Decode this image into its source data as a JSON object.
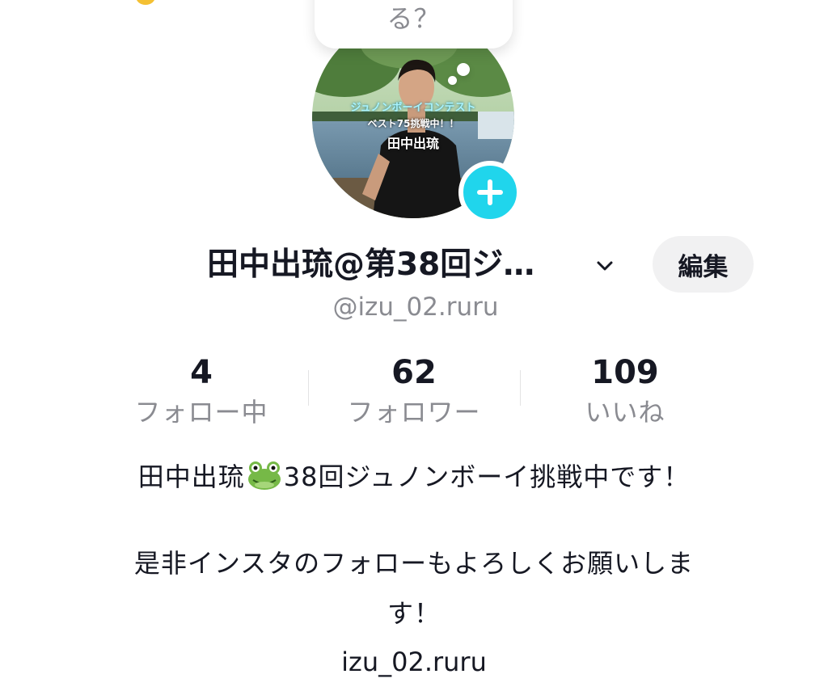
{
  "speech_bubble": {
    "text": "る？"
  },
  "avatar": {
    "overlay_line1": "ジュノンボーイコンテスト",
    "overlay_line2": "ベスト75挑戦中！！",
    "overlay_line3": "田中出琉",
    "add_icon": "plus-icon"
  },
  "profile": {
    "display_name": "田中出琉@第38回ジ…",
    "name_chevron_icon": "chevron-down-icon",
    "edit_label": "編集",
    "username": "@izu_02.ruru"
  },
  "stats": [
    {
      "count": "4",
      "label": "フォロー中"
    },
    {
      "count": "62",
      "label": "フォロワー"
    },
    {
      "count": "109",
      "label": "いいね"
    }
  ],
  "bio": {
    "line1_pre": "田中出琉",
    "line1_post": "38回ジュノンボーイ挑戦中です！",
    "line2": "是非インスタのフォローもよろしくお願いしま",
    "line3": "す！",
    "link": "izu_02.ruru"
  },
  "colors": {
    "accent_cyan": "#20d5ec",
    "text_primary": "#161823",
    "text_secondary": "#8a8b91",
    "edit_button_bg": "#f1f1f2"
  }
}
